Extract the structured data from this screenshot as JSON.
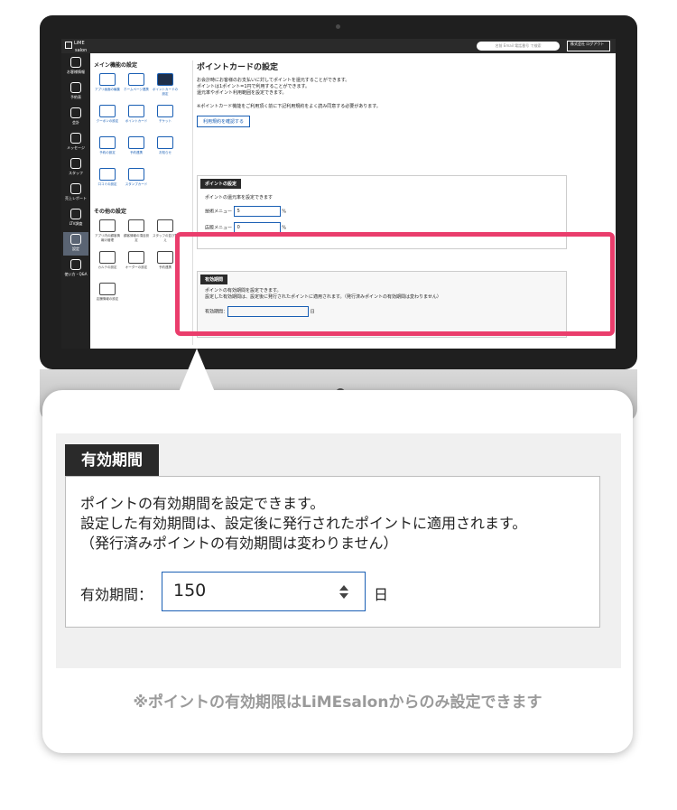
{
  "app": {
    "logo_line1": "LiME",
    "logo_line2": "salon",
    "search_placeholder": "名前 Email 電話番号 で検索",
    "account_label": "株式会社 ログアウト"
  },
  "leftnav": [
    "お客様情報",
    "予約表",
    "会計",
    "メッセージ",
    "スタッフ",
    "売上レポート",
    "LTV調査",
    "設定",
    "使い方・Q&A"
  ],
  "features": {
    "main_title": "メイン機能の設定",
    "main_tiles": [
      "アプリ画面の編集",
      "ホームページ連携",
      "ポイントカードの設定",
      "クーポンの設定",
      "ポイントカード",
      "チケット",
      "予約の設定",
      "予約連携",
      "お知らせ",
      "口コミの設定",
      "スタンプカード"
    ],
    "other_title": "その他の設定",
    "other_tiles": [
      "アプリ内の顧客情報の管理",
      "顧客情報の項目設定",
      "スタッフの並び替え",
      "カルテの設定",
      "オーダーの設定",
      "予約連携",
      "店舗情報の設定"
    ]
  },
  "main": {
    "title": "ポイントカードの設定",
    "intro": [
      "お会計時にお客様のお支払いに対してポイントを還元することができます。",
      "ポイントは1ポイント=1円で利用することができます。",
      "還元率やポイント利用範囲を設定できます。"
    ],
    "notice": "※ポイントカード機能をご利用頂く前に下記利用規約をよく読み同意する必要があります。",
    "terms_button": "利用規約を確認する",
    "point_section": {
      "title": "ポイントの設定",
      "desc": "ポイントの還元率を設定できます",
      "tech_label": "技術メニュー",
      "tech_value": "5",
      "retail_label": "店販メニュー",
      "retail_value": "0",
      "unit": "%"
    },
    "expiry_small": {
      "title": "有効期間",
      "line1": "ポイントの有効期間を設定できます。",
      "line2": "設定した有効期間は、設定後に発行されたポイントに適用されます。（発行済みポイントの有効期間は変わりません）",
      "label": "有効期間：",
      "unit": "日"
    }
  },
  "callout": {
    "title": "有効期間",
    "desc": [
      "ポイントの有効期間を設定できます。",
      "設定した有効期間は、設定後に発行されたポイントに適用されます。",
      "（発行済みポイントの有効期間は変わりません）"
    ],
    "field_label": "有効期間：",
    "field_value": "150",
    "unit": "日",
    "note": "※ポイントの有効期限はLiMEsalonからのみ設定できます"
  },
  "colors": {
    "highlight": "#ea3d6c",
    "accent": "#1a5fb4",
    "dark": "#2a2a2a"
  }
}
